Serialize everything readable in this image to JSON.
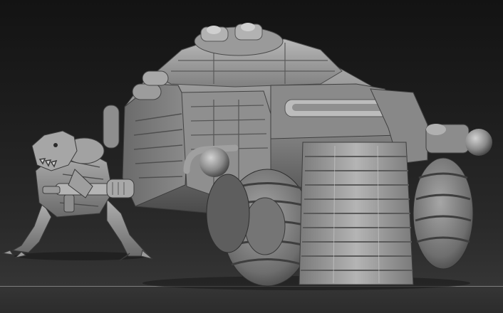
{
  "scene": {
    "subjects": [
      "creature-figure",
      "armored-tank"
    ],
    "palette": {
      "background_top": "#131313",
      "background_bottom": "#3a3a3a",
      "sculpt_light": "#b5b5b5",
      "sculpt_mid": "#7d7d7d",
      "sculpt_dark": "#3f3f3f",
      "floor_line": "#8a8a8a"
    }
  }
}
